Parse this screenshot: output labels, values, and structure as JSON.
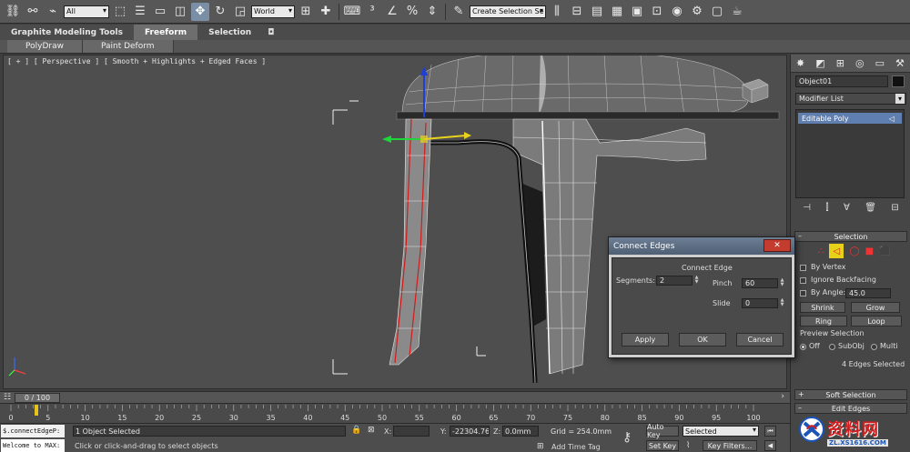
{
  "toolbar": {
    "selection_filter": "All",
    "coord_system": "World",
    "named_selection_placeholder": "Create Selection Se",
    "icons": [
      "undo-icon",
      "redo-icon",
      "link-icon",
      "unlink-icon",
      "bind-icon",
      "select-icon",
      "select-by-name-icon",
      "rect-region-icon",
      "window-crossing-icon",
      "move-icon",
      "rotate-icon",
      "scale-icon",
      "pivot-icon",
      "select-manipulate-icon",
      "keyboard-shortcut-icon",
      "snaps-toggle-icon",
      "angle-snap-icon",
      "percent-snap-icon",
      "spinner-snap-icon",
      "edit-named-selection-icon",
      "mirror-icon",
      "align-icon",
      "layer-manager-icon",
      "graphite-toggle-icon",
      "curve-editor-icon",
      "schematic-view-icon",
      "material-editor-icon",
      "render-setup-icon",
      "rendered-frame-icon",
      "render-icon"
    ]
  },
  "ribbon": {
    "tabs": [
      {
        "label": "Graphite Modeling Tools",
        "active": false
      },
      {
        "label": "Freeform",
        "active": true
      },
      {
        "label": "Selection",
        "active": false
      }
    ],
    "panel_buttons": [
      "PolyDraw",
      "Paint Deform"
    ]
  },
  "viewport": {
    "label": "[ + ] [ Perspective ] [ Smooth + Highlights + Edged Faces ]"
  },
  "command_panel": {
    "object_name": "Object01",
    "modifier_list": "Modifier List",
    "stack_item": "Editable Poly",
    "selection_rollout": "Selection",
    "by_vertex": "By Vertex",
    "ignore_backfacing": "Ignore Backfacing",
    "by_angle": "By Angle:",
    "by_angle_value": "45.0",
    "shrink": "Shrink",
    "grow": "Grow",
    "ring": "Ring",
    "loop": "Loop",
    "preview_selection": "Preview Selection",
    "preview_off": "Off",
    "preview_subobj": "SubObj",
    "preview_multi": "Multi",
    "selected_count": "4 Edges Selected",
    "soft_selection": "Soft Selection",
    "edit_edges": "Edit Edges"
  },
  "dialog": {
    "title": "Connect Edges",
    "group_label": "Connect Edge",
    "segments_label": "Segments:",
    "segments_value": "2",
    "pinch_label": "Pinch",
    "pinch_value": "60",
    "slide_label": "Slide",
    "slide_value": "0",
    "apply": "Apply",
    "ok": "OK",
    "cancel": "Cancel"
  },
  "time_slider": {
    "current": "0 / 100",
    "ticks": [
      "0",
      "5",
      "10",
      "15",
      "20",
      "25",
      "30",
      "35",
      "40",
      "45",
      "50",
      "55",
      "60",
      "65",
      "70",
      "75",
      "80",
      "85",
      "90",
      "95",
      "100"
    ]
  },
  "status": {
    "maxscript_line1": "$.connectEdgeP:",
    "maxscript_line2": "Welcome to MAX:",
    "objects_selected": "1 Object Selected",
    "prompt": "Click or click-and-drag to select objects",
    "x_label": "X:",
    "x_value": "",
    "y_label": "Y:",
    "y_value": "-22304.76:",
    "z_label": "Z:",
    "z_value": "0.0mm",
    "grid": "Grid = 254.0mm",
    "add_time_tag": "Add Time Tag",
    "auto_key": "Auto Key",
    "set_key": "Set Key",
    "key_mode": "Selected",
    "key_filters": "Key Filters..."
  },
  "watermark": {
    "title": "资料网",
    "url": "ZL.XS1616.COM"
  }
}
